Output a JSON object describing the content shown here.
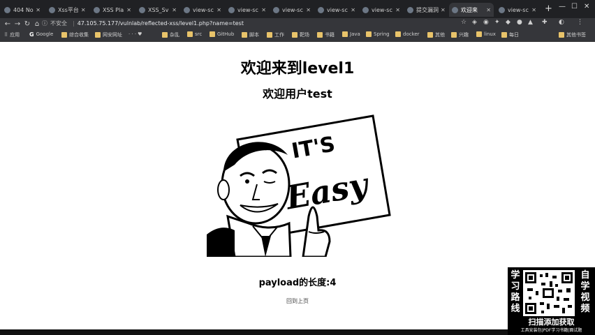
{
  "tabs": [
    {
      "title": "404 No"
    },
    {
      "title": "Xss平台"
    },
    {
      "title": "XSS Pla"
    },
    {
      "title": "XSS_Sv"
    },
    {
      "title": "view-sc"
    },
    {
      "title": "view-sc"
    },
    {
      "title": "view-sc"
    },
    {
      "title": "view-sc"
    },
    {
      "title": "view-sc"
    },
    {
      "title": "提交漏洞"
    },
    {
      "title": "欢迎来"
    },
    {
      "title": "view-sc"
    }
  ],
  "toolbar": {
    "insecure_label": "不安全",
    "url": "47.105.75.177/vulnlab/reflected-xss/level1.php?name=test"
  },
  "bookmarks": [
    {
      "label": "应用"
    },
    {
      "label": "Google"
    },
    {
      "label": "综合收集"
    },
    {
      "label": "网安网址"
    },
    {
      "label": "杂乱"
    },
    {
      "label": "src"
    },
    {
      "label": "GitHub"
    },
    {
      "label": "脚本"
    },
    {
      "label": "工作"
    },
    {
      "label": "靶场"
    },
    {
      "label": "书籍"
    },
    {
      "label": "Java"
    },
    {
      "label": "Spring"
    },
    {
      "label": "docker"
    },
    {
      "label": "其他"
    },
    {
      "label": "兴趣"
    },
    {
      "label": "linux"
    },
    {
      "label": "每日"
    },
    {
      "label": "其他书签"
    }
  ],
  "page": {
    "title": "欢迎来到level1",
    "welcome": "欢迎用户test",
    "illustration_text": "IT'S Easy",
    "payload_text": "payload的长度:4",
    "back_link": "回到上页"
  },
  "promo": {
    "left_vertical": "学习路线",
    "right_vertical": "自学视频",
    "cta": "扫描添加获取",
    "tags": "工具安装包|PDF学习书籍|面试题"
  },
  "colors": {
    "tab_bar": "#202124",
    "toolbar": "#35363a",
    "page_bg": "#ffffff"
  }
}
